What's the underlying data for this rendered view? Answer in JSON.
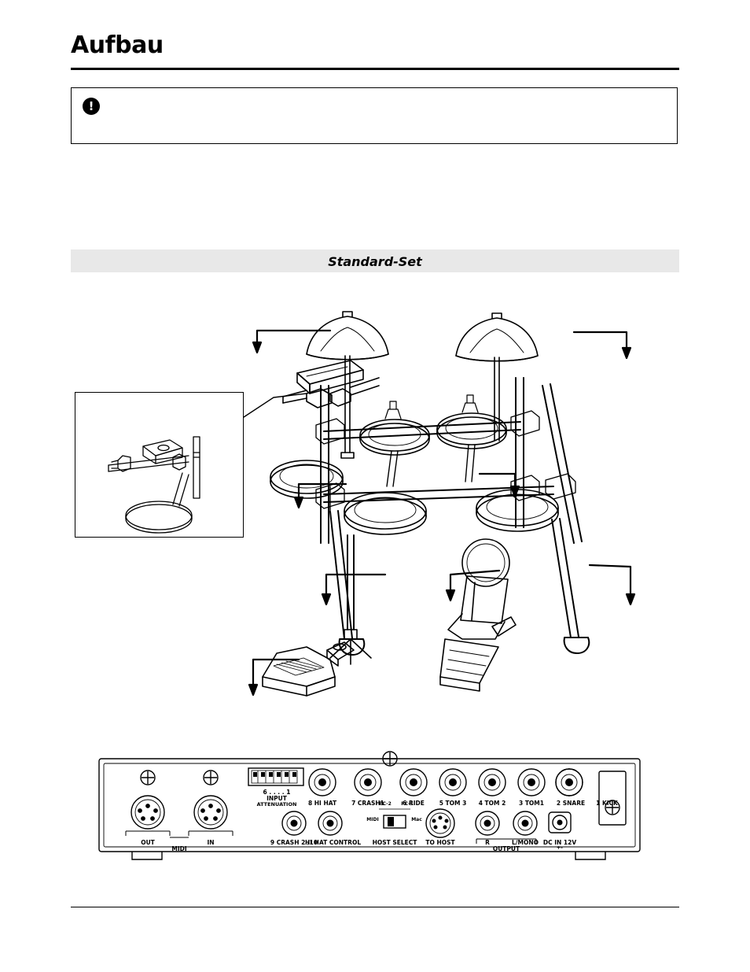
{
  "document": {
    "title": "Aufbau",
    "warning": {
      "icon": "warning-exclamation-icon",
      "text": ""
    },
    "section": {
      "label": "Standard-Set"
    },
    "footer": {
      "text": "",
      "page": ""
    }
  },
  "figure": {
    "name": "drum-kit-assembly-diagram",
    "inset": {
      "name": "module-mount-detail",
      "label": ""
    },
    "callouts": []
  },
  "rear_panel": {
    "name": "module-rear-panel-diagram",
    "dip_switch": {
      "label_line1": "INPUT",
      "label_line2": "ATTENUATION",
      "scale_left": "6",
      "scale_dots": ". . . .",
      "scale_right": "1"
    },
    "jacks_top": [
      {
        "label": "8 HI HAT",
        "name": "jack-8-hi-hat"
      },
      {
        "label": "7 CRASH1",
        "name": "jack-7-crash1"
      },
      {
        "label": "6 RIDE",
        "name": "jack-6-ride"
      },
      {
        "label": "5 TOM 3",
        "name": "jack-5-tom-3"
      },
      {
        "label": "4 TOM 2",
        "name": "jack-4-tom-2"
      },
      {
        "label": "3 TOM1",
        "name": "jack-3-tom-1"
      },
      {
        "label": "2 SNARE",
        "name": "jack-2-snare"
      },
      {
        "label": "1 KICK",
        "name": "jack-1-kick"
      }
    ],
    "jacks_bottom": [
      {
        "label": "9 CRASH 2 /10",
        "name": "jack-9-crash-2"
      },
      {
        "label": "HI HAT CONTROL",
        "name": "jack-hi-hat-control"
      }
    ],
    "midi": {
      "group_label": "MIDI",
      "out_label": "OUT",
      "in_label": "IN"
    },
    "host": {
      "pc2_label": "PC-2",
      "pc1_label": "PC-1",
      "midi_label": "MIDI",
      "mac_label": "Mac",
      "select_label": "HOST SELECT",
      "to_host_label": "TO HOST"
    },
    "output": {
      "r_label": "R",
      "lmono_label": "L/MONO",
      "group_label": "OUTPUT"
    },
    "power": {
      "label": "DC IN 12V",
      "polarity": "+–"
    }
  }
}
